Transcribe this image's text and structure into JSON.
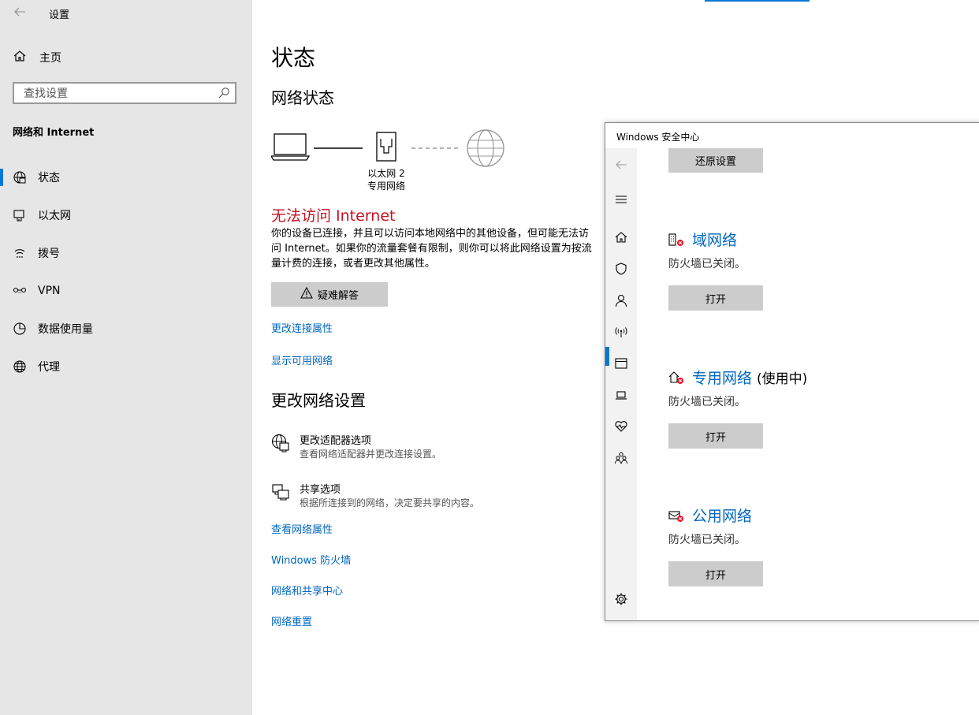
{
  "settings": {
    "app_title": "设置",
    "home_label": "主页",
    "search_placeholder": "查找设置",
    "section_label": "网络和 Internet",
    "nav": [
      {
        "label": "状态",
        "icon": "status-globe-icon"
      },
      {
        "label": "以太网",
        "icon": "ethernet-icon"
      },
      {
        "label": "拨号",
        "icon": "dialup-icon"
      },
      {
        "label": "VPN",
        "icon": "vpn-icon"
      },
      {
        "label": "数据使用量",
        "icon": "data-usage-icon"
      },
      {
        "label": "代理",
        "icon": "proxy-globe-icon"
      }
    ],
    "active_nav": "状态"
  },
  "main": {
    "page_title": "状态",
    "network_status_heading": "网络状态",
    "adapter_name": "以太网 2",
    "network_type": "专用网络",
    "warning_title": "无法访问 Internet",
    "warning_text": "你的设备已连接，并且可以访问本地网络中的其他设备，但可能无法访问 Internet。如果你的流量套餐有限制，则你可以将此网络设置为按流量计费的连接，或者更改其他属性。",
    "troubleshoot_label": "疑难解答",
    "link_change_connection": "更改连接属性",
    "link_show_networks": "显示可用网络",
    "change_settings_heading": "更改网络设置",
    "options": [
      {
        "title": "更改适配器选项",
        "subtitle": "查看网络适配器并更改连接设置。",
        "icon": "adapter-icon"
      },
      {
        "title": "共享选项",
        "subtitle": "根据所连接到的网络，决定要共享的内容。",
        "icon": "sharing-icon"
      }
    ],
    "link_view_properties": "查看网络属性",
    "link_firewall": "Windows 防火墙",
    "link_sharing_center": "网络和共享中心",
    "link_reset": "网络重置"
  },
  "security": {
    "window_title": "Windows 安全中心",
    "reset_label": "还原设置",
    "networks": [
      {
        "name": "域网络",
        "in_use": "",
        "state": "防火墙已关闭。",
        "button": "打开",
        "icon": "domain-network-icon"
      },
      {
        "name": "专用网络",
        "in_use": "(使用中)",
        "state": "防火墙已关闭。",
        "button": "打开",
        "icon": "private-network-icon"
      },
      {
        "name": "公用网络",
        "in_use": "",
        "state": "防火墙已关闭。",
        "button": "打开",
        "icon": "public-network-icon"
      }
    ]
  },
  "colors": {
    "accent": "#0078d7",
    "link": "#0067c0",
    "warning": "#c50f1f",
    "sidebar_bg": "#e6e6e6",
    "button_bg": "#cccccc"
  }
}
